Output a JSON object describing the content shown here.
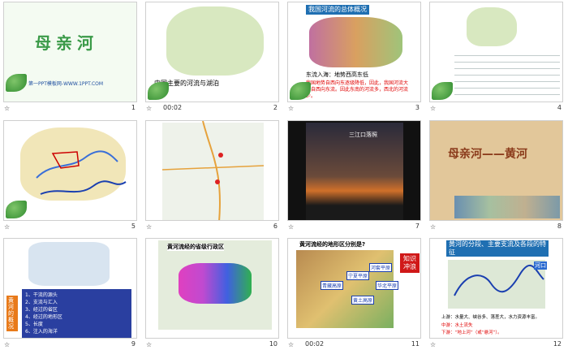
{
  "slides": [
    {
      "num": "1",
      "time": "",
      "title": "母亲河",
      "footer": "第一PPT模板网-WWW.1PPT.COM"
    },
    {
      "num": "2",
      "time": "00:02",
      "title": "中国主要的河流与湖泊"
    },
    {
      "num": "3",
      "time": "",
      "title": "我国河流的总体概况",
      "line1": "东流入海：地势西高东低",
      "line2": "我国地势自西向东逐级降低，因此，我国河流大都自西向东流。因此东南的河流多，西北的河流少。"
    },
    {
      "num": "4",
      "time": ""
    },
    {
      "num": "5",
      "time": ""
    },
    {
      "num": "6",
      "time": ""
    },
    {
      "num": "7",
      "time": "",
      "title": "三江口落照"
    },
    {
      "num": "8",
      "time": "",
      "title": "母亲河——黄河"
    },
    {
      "num": "9",
      "time": "",
      "side": "黄河的概况",
      "items": [
        "1、干流的源头",
        "2、支流与汇入",
        "3、经过的省区",
        "4、经过的地形区",
        "5、长度",
        "6、注入的海洋"
      ]
    },
    {
      "num": "10",
      "time": "",
      "title": "黄河流经的省级行政区"
    },
    {
      "num": "11",
      "time": "00:02",
      "title": "黄河流经的地形区分别是?",
      "labels": [
        "宁夏平原",
        "河套平原",
        "青藏高原",
        "黄土高原",
        "华北平原"
      ],
      "side": "知识冲浪"
    },
    {
      "num": "12",
      "time": "",
      "title": "黄河的分段、主要支流及各段的特征",
      "labels": [
        "河口",
        "上游",
        "中游",
        "下游"
      ],
      "bottom1": "上游：水量大、峡谷多、落差大，水力资源丰富。",
      "bottom2": "中游：水土流失",
      "bottom3": "下游：“地上河”（或“悬河”）。"
    }
  ]
}
